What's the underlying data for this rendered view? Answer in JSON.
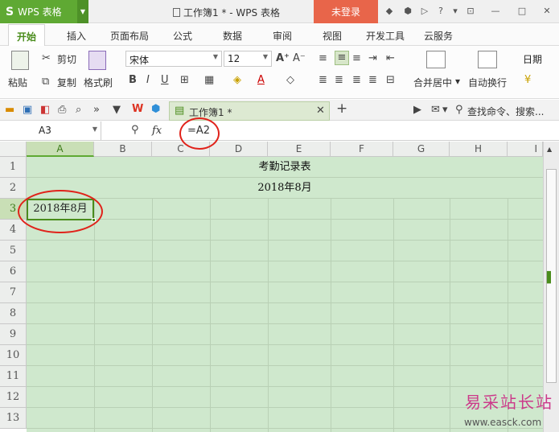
{
  "app": {
    "logo_mark": "S",
    "logo_text": "WPS 表格",
    "doc_title": "工作簿1 * - WPS 表格",
    "login_label": "未登录"
  },
  "menu": {
    "tabs": [
      "开始",
      "插入",
      "页面布局",
      "公式",
      "数据",
      "审阅",
      "视图",
      "开发工具",
      "云服务"
    ]
  },
  "ribbon": {
    "paste": "粘贴",
    "cut": "剪切",
    "copy": "复制",
    "format_painter": "格式刷",
    "font_name": "宋体",
    "font_size": "12",
    "merge_center": "合并居中",
    "wrap_text": "自动换行",
    "number_format": "日期"
  },
  "tabbar": {
    "doc_tab": "工作簿1 *",
    "search_placeholder": "查找命令、搜索..."
  },
  "formula_bar": {
    "name_box": "A3",
    "fx": "fx",
    "formula": "=A2"
  },
  "grid": {
    "columns": [
      "A",
      "B",
      "C",
      "D",
      "E",
      "F",
      "G",
      "H",
      "I"
    ],
    "rows": [
      "1",
      "2",
      "3",
      "4",
      "5",
      "6",
      "7",
      "8",
      "9",
      "10",
      "11",
      "12",
      "13"
    ],
    "selected_cell": "A3",
    "cells": {
      "row1": "考勤记录表",
      "row2": "2018年8月",
      "a3": "2018年8月"
    }
  },
  "watermark": {
    "title": "易采站长站",
    "url": "www.easck.com"
  },
  "colors": {
    "brand": "#5fa933",
    "login": "#e8654a",
    "sheet_bg": "#cfe8cd",
    "annotation": "#e0221a"
  }
}
